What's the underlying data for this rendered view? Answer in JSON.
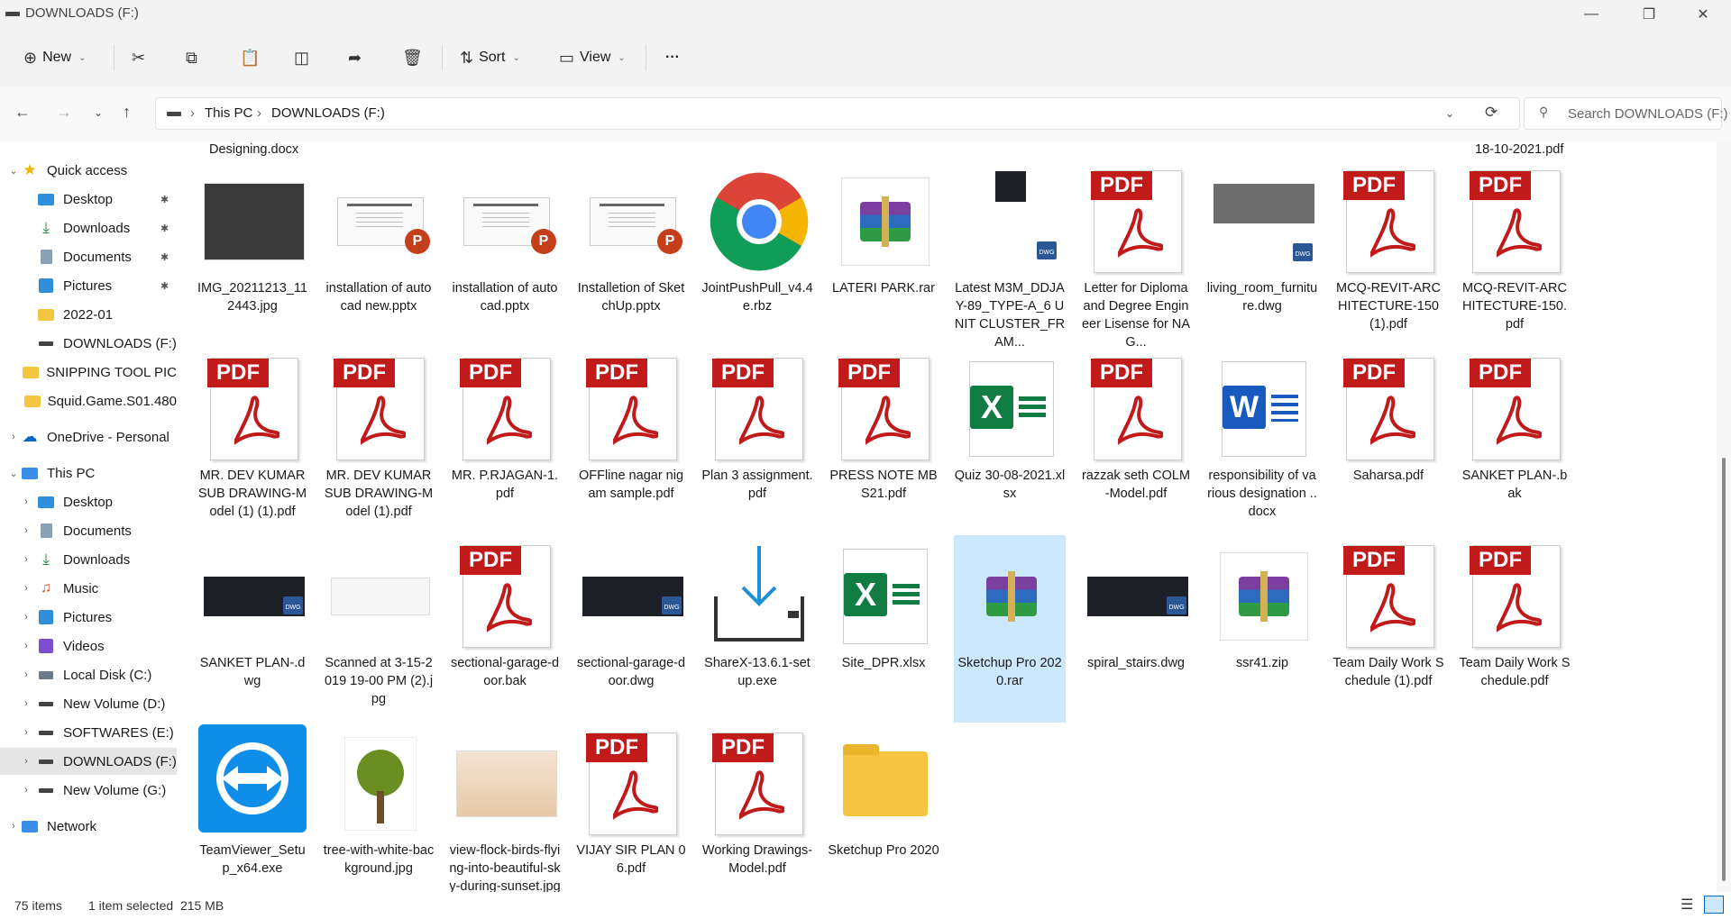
{
  "window": {
    "title": "DOWNLOADS (F:)"
  },
  "toolbar": {
    "new_label": "New",
    "sort_label": "Sort",
    "view_label": "View",
    "more_label": "···"
  },
  "address": {
    "crumbs": [
      "This PC",
      "DOWNLOADS (F:)"
    ],
    "search_placeholder": "Search DOWNLOADS (F:)"
  },
  "sidebar": {
    "quick_access": "Quick access",
    "quick_items": [
      "Desktop",
      "Downloads",
      "Documents",
      "Pictures",
      "2022-01",
      "DOWNLOADS (F:)",
      "SNIPPING TOOL PIC",
      "Squid.Game.S01.480"
    ],
    "onedrive": "OneDrive - Personal",
    "this_pc": "This PC",
    "pc_items": [
      "Desktop",
      "Documents",
      "Downloads",
      "Music",
      "Pictures",
      "Videos",
      "Local Disk (C:)",
      "New Volume (D:)",
      "SOFTWARES (E:)",
      "DOWNLOADS (F:)",
      "New Volume (G:)"
    ],
    "network": "Network"
  },
  "content": {
    "top_partial": {
      "left": "Designing.docx",
      "right": "18-10-2021.pdf"
    },
    "files": [
      {
        "name": "IMG_20211213_112443.jpg",
        "type": "photo",
        "color": "#3a3a3a"
      },
      {
        "name": "installation of autocad new.pptx",
        "type": "pptx"
      },
      {
        "name": "installation of autocad.pptx",
        "type": "pptx"
      },
      {
        "name": "Installetion of SketchUp.pptx",
        "type": "pptx"
      },
      {
        "name": "JointPushPull_v4.4e.rbz",
        "type": "chrome"
      },
      {
        "name": "LATERI PARK.rar",
        "type": "rarbox"
      },
      {
        "name": "Latest M3M_DDJAY-89_TYPE-A_6 UNIT CLUSTER_FRAM...",
        "type": "dwgsmall"
      },
      {
        "name": "Letter for Diploma and Degree Engineer Lisense for NAG...",
        "type": "pdf"
      },
      {
        "name": "living_room_furniture.dwg",
        "type": "dwggrey"
      },
      {
        "name": "MCQ-REVIT-ARCHITECTURE-150 (1).pdf",
        "type": "pdf"
      },
      {
        "name": "MCQ-REVIT-ARCHITECTURE-150.pdf",
        "type": "pdf"
      },
      {
        "name": "MR. DEV KUMAR SUB DRAWING-Model (1) (1).pdf",
        "type": "pdf"
      },
      {
        "name": "MR. DEV KUMAR SUB DRAWING-Model (1).pdf",
        "type": "pdf"
      },
      {
        "name": "MR. P.RJAGAN-1.pdf",
        "type": "pdf"
      },
      {
        "name": "OFFline nagar nigam sample.pdf",
        "type": "pdf"
      },
      {
        "name": "Plan 3 assignment.pdf",
        "type": "pdf"
      },
      {
        "name": "PRESS NOTE MBS21.pdf",
        "type": "pdf"
      },
      {
        "name": "Quiz 30-08-2021.xlsx",
        "type": "xlsx"
      },
      {
        "name": "razzak seth COLM -Model.pdf",
        "type": "pdf"
      },
      {
        "name": "responsibility of various designation ..docx",
        "type": "docx"
      },
      {
        "name": "Saharsa.pdf",
        "type": "pdf"
      },
      {
        "name": "SANKET PLAN-.bak",
        "type": "pdf"
      },
      {
        "name": "SANKET PLAN-.dwg",
        "type": "dwg"
      },
      {
        "name": "Scanned at 3-15-2019 19-00 PM (2).jpg",
        "type": "scan"
      },
      {
        "name": "sectional-garage-door.bak",
        "type": "pdf"
      },
      {
        "name": "sectional-garage-door.dwg",
        "type": "dwg"
      },
      {
        "name": "ShareX-13.6.1-setup.exe",
        "type": "sharex"
      },
      {
        "name": "Site_DPR.xlsx",
        "type": "xlsx"
      },
      {
        "name": "Sketchup Pro 2020.rar",
        "type": "rar",
        "selected": true
      },
      {
        "name": "spiral_stairs.dwg",
        "type": "dwg"
      },
      {
        "name": "ssr41.zip",
        "type": "rarbox"
      },
      {
        "name": "Team Daily Work Schedule (1).pdf",
        "type": "pdf"
      },
      {
        "name": "Team Daily Work Schedule.pdf",
        "type": "pdf"
      },
      {
        "name": "TeamViewer_Setup_x64.exe",
        "type": "teamviewer"
      },
      {
        "name": "tree-with-white-background.jpg",
        "type": "tree"
      },
      {
        "name": "view-flock-birds-flying-into-beautiful-sky-during-sunset.jpg",
        "type": "sunset"
      },
      {
        "name": "VIJAY SIR PLAN 06.pdf",
        "type": "pdf"
      },
      {
        "name": "Working Drawings-Model.pdf",
        "type": "pdf"
      },
      {
        "name": "Sketchup Pro 2020",
        "type": "folder"
      }
    ]
  },
  "status": {
    "count": "75 items",
    "selected": "1 item selected  215 MB"
  },
  "colors": {
    "accent": "#0067c0",
    "selected_tile": "#cce8ff",
    "pdf_red": "#c01a1a"
  }
}
